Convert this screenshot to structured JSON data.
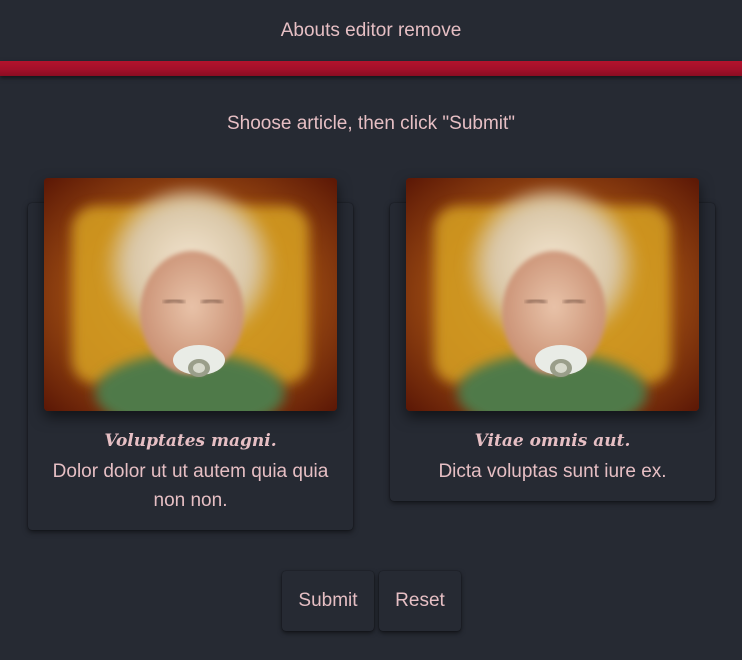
{
  "header": {
    "title": "Abouts editor remove"
  },
  "colors": {
    "background": "#262a33",
    "accent_bar": "#a3102a",
    "text": "#e6bfc4"
  },
  "instruction": "Shoose article, then click \"Submit\"",
  "articles": [
    {
      "image": "child-with-pacifier-photo",
      "title": "Voluptates magni.",
      "text": "Dolor dolor ut ut autem quia quia non non."
    },
    {
      "image": "child-with-pacifier-photo",
      "title": "Vitae omnis aut.",
      "text": "Dicta voluptas sunt iure ex."
    }
  ],
  "actions": {
    "submit_label": "Submit",
    "reset_label": "Reset"
  }
}
